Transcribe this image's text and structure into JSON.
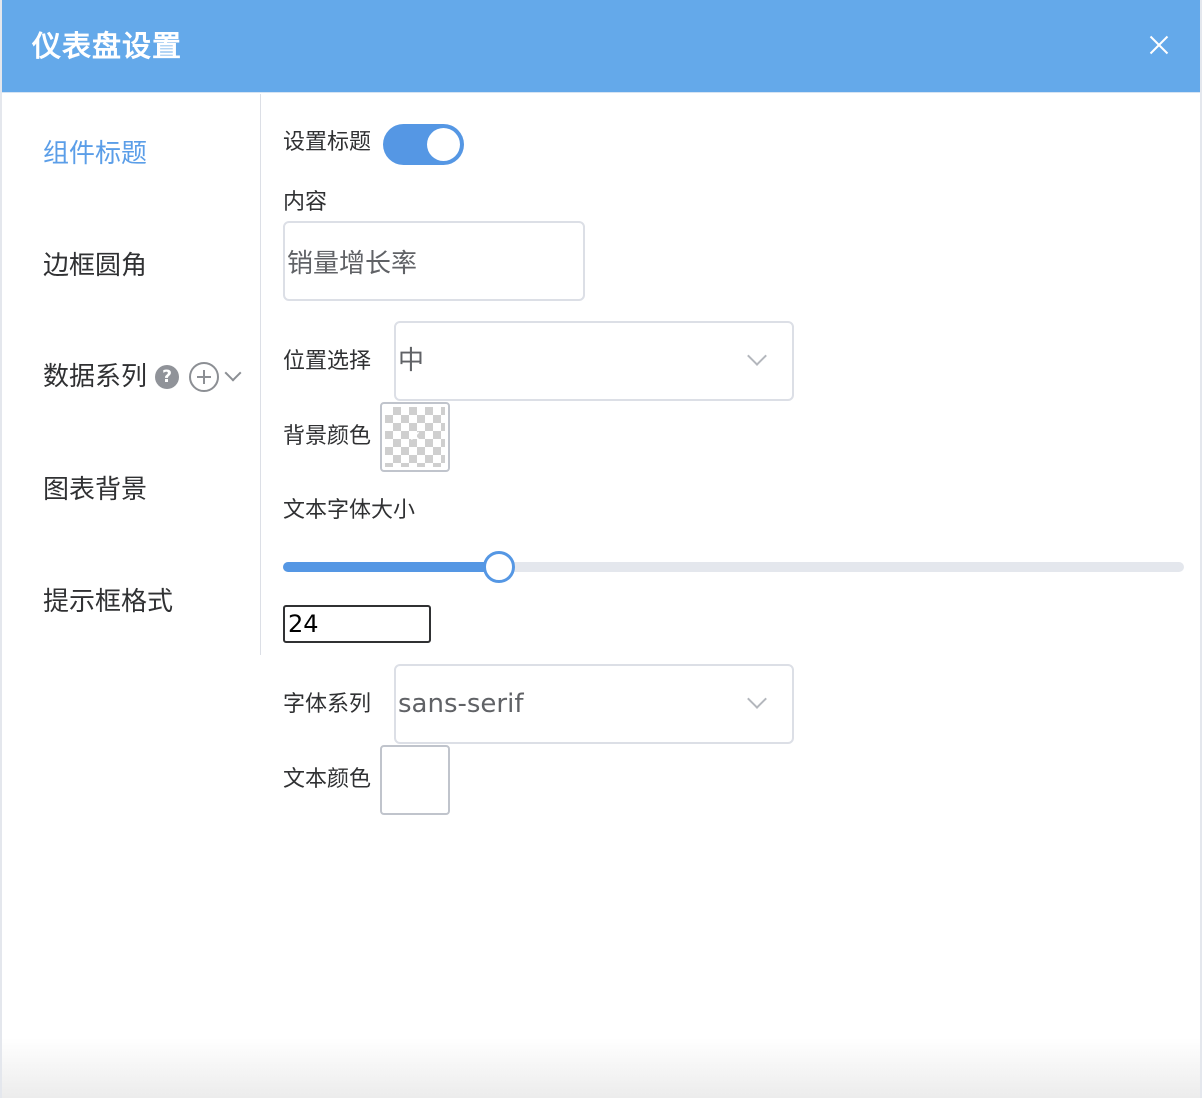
{
  "dialog": {
    "title": "仪表盘设置"
  },
  "sidebar": {
    "items": [
      {
        "label": "组件标题",
        "active": true
      },
      {
        "label": "边框圆角",
        "active": false
      },
      {
        "label": "数据系列",
        "active": false,
        "help_glyph": "?"
      },
      {
        "label": "图表背景",
        "active": false
      },
      {
        "label": "提示框格式",
        "active": false
      }
    ]
  },
  "form": {
    "show_title_label": "设置标题",
    "show_title_on": true,
    "content_label": "内容",
    "content_value": "销量增长率",
    "position_label": "位置选择",
    "position_value": "中",
    "bg_color_label": "背景颜色",
    "bg_color_value": "transparent",
    "font_size_label": "文本字体大小",
    "font_size_value": "24",
    "font_size_fraction": 0.24,
    "font_family_label": "字体系列",
    "font_family_value": "sans-serif",
    "text_color_label": "文本颜色",
    "text_color_value": "#ffffff"
  },
  "colors": {
    "header": "#64a9ea",
    "accent": "#5597e4",
    "active_nav": "#5b9ee8"
  },
  "icons": {
    "close": "close-icon",
    "help": "help-icon",
    "add": "plus-circle-icon",
    "expand": "chevron-down-icon",
    "select_arrow": "chevron-down-icon"
  }
}
